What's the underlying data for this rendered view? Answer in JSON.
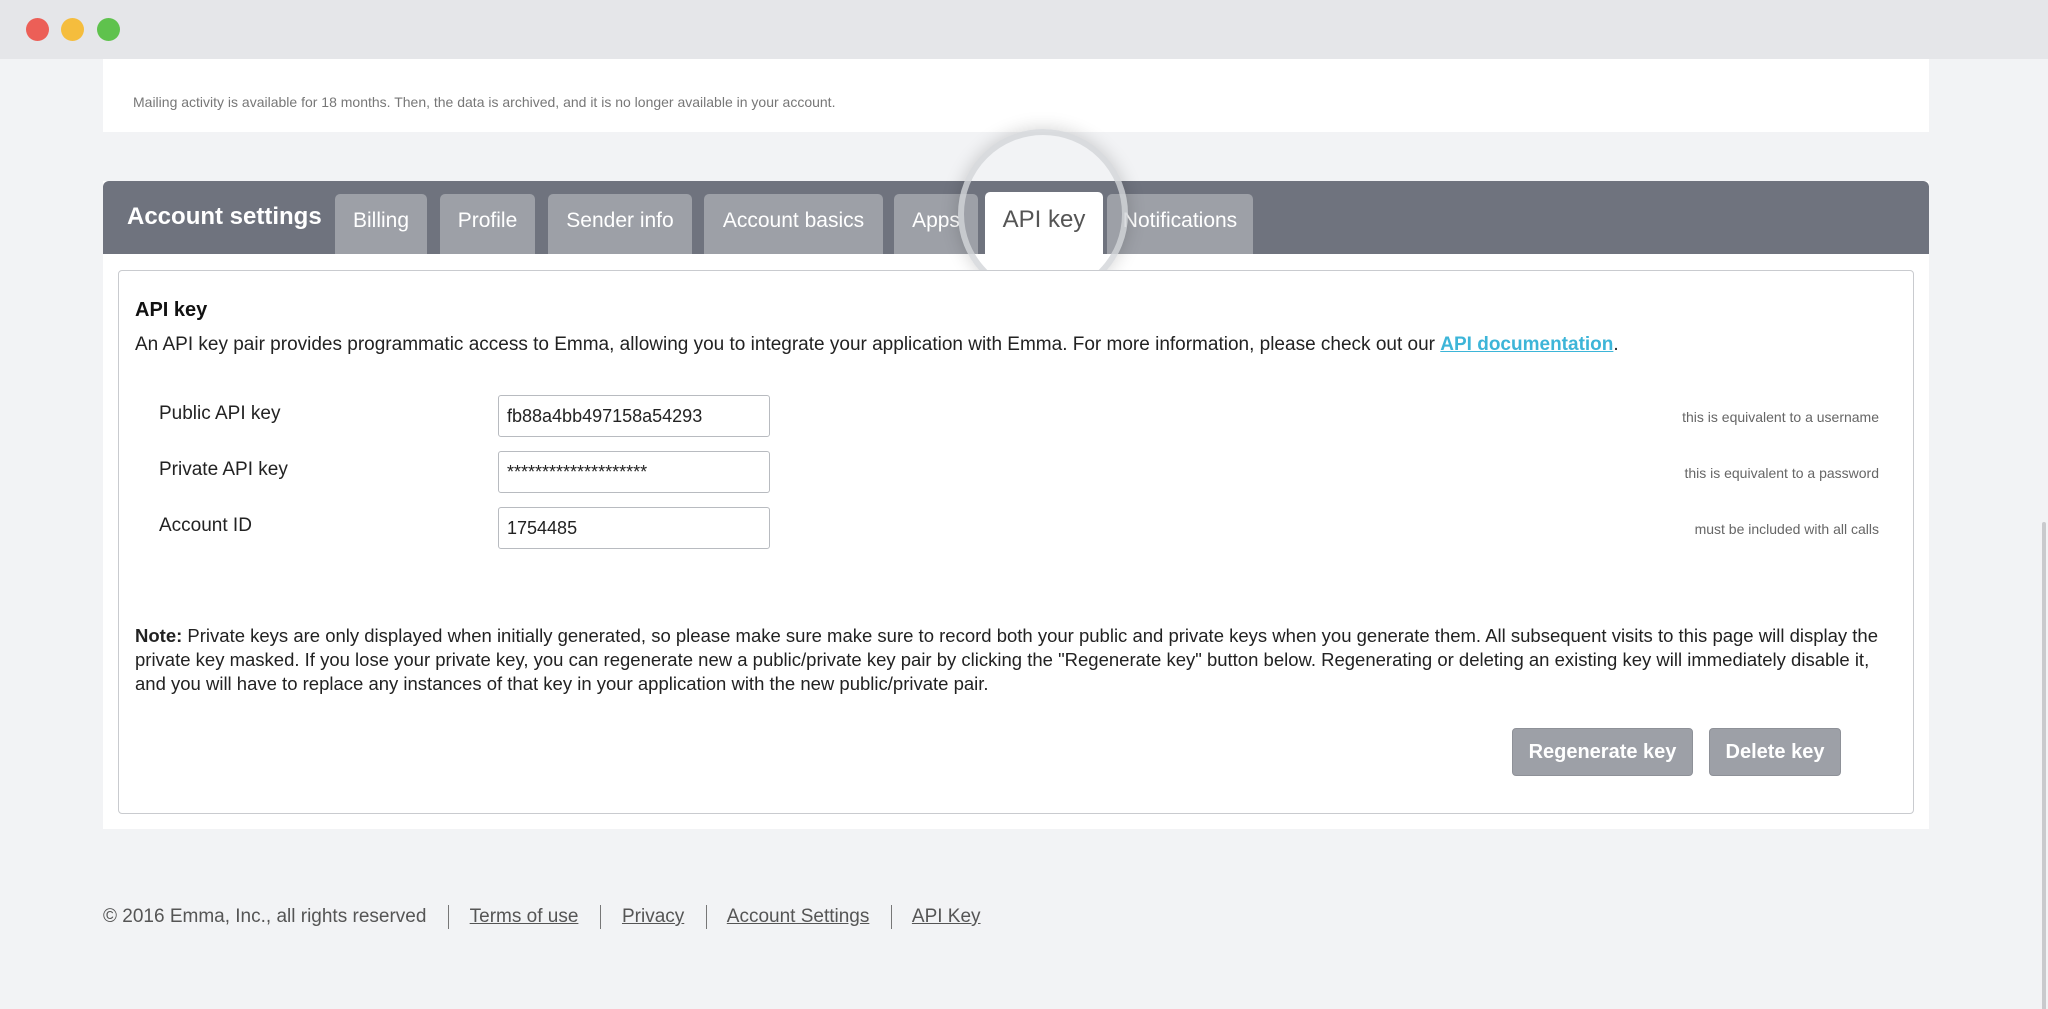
{
  "window": {
    "controls": [
      "close",
      "minimize",
      "maximize"
    ]
  },
  "archive_notice": "Mailing activity is available for 18 months. Then, the data is archived, and it is no longer available in your account.",
  "settings": {
    "heading": "Account settings",
    "tabs": [
      {
        "label": "Billing"
      },
      {
        "label": "Profile"
      },
      {
        "label": "Sender info"
      },
      {
        "label": "Account basics"
      },
      {
        "label": "Apps"
      },
      {
        "label": "API key",
        "active": true
      },
      {
        "label": "Notifications"
      }
    ]
  },
  "api": {
    "title": "API key",
    "intro": "An API key pair provides programmatic access to Emma, allowing you to integrate your application with Emma. For more information, please check out our ",
    "doc_link": "API documentation",
    "intro_end": ".",
    "fields": [
      {
        "label": "Public API key",
        "value": "fb88a4bb497158a54293",
        "hint": "this is equivalent to a username"
      },
      {
        "label": "Private API key",
        "value": "********************",
        "hint": "this is equivalent to a password"
      },
      {
        "label": "Account ID",
        "value": "1754485",
        "hint": "must be included with all calls"
      }
    ],
    "note_label": "Note:",
    "note_text": " Private keys are only displayed when initially generated, so please make sure make sure to record both your public and private keys when you generate them. All subsequent visits to this page will display the private key masked. If you lose your private key, you can regenerate new a public/private key pair by clicking the \"Regenerate key\" button below. Regenerating or deleting an existing key will immediately disable it, and you will have to replace any instances of that key in your application with the new public/private pair.",
    "buttons": {
      "regenerate": "Regenerate key",
      "delete": "Delete key"
    }
  },
  "footer": {
    "copyright": "© 2016 Emma, Inc., all rights reserved",
    "links": [
      "Terms of use",
      "Privacy",
      "Account Settings",
      "API Key"
    ]
  },
  "colors": {
    "tabbar": "#6f737e",
    "tab": "#9da0a7",
    "link": "#3db5d8",
    "background": "#f2f3f5"
  }
}
